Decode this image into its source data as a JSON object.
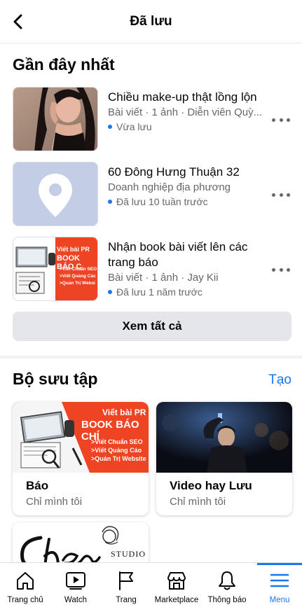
{
  "header": {
    "title": "Đã lưu"
  },
  "recent": {
    "title": "Gần đây nhất",
    "items": [
      {
        "title": "Chiều make-up thật lồng lộn",
        "meta": "Bài viết · 1 ảnh · Diễn viên Quỳ...",
        "saved": "Vừa lưu",
        "thumb": "portrait-photo"
      },
      {
        "title": "60 Đông Hưng Thuận 32",
        "meta": "Doanh nghiệp địa phương",
        "saved": "Đã lưu 10 tuần trước",
        "thumb": "location-pin-icon"
      },
      {
        "title": "Nhận book bài viết lên các trang báo",
        "meta": "Bài viết · 1 ảnh · Jay Kii",
        "saved": "Đã lưu 1 năm trước",
        "thumb": "pr-promo-image"
      }
    ],
    "see_all": "Xem tất cả"
  },
  "collections": {
    "title": "Bộ sưu tập",
    "create": "Tạo",
    "promo": {
      "l1": "Viết bài PR",
      "l2": "BOOK BÁO CHÍ",
      "l3": ">Viết Chuẩn SEO",
      "l4": ">Viết Quảng Cáo",
      "l5": ">Quản Trị Website"
    },
    "promo_small": {
      "l1": "Viết bài PR",
      "l2": "BOOK BÁO C",
      "l3": ">Viết Chuẩn SEO",
      "l4": ">Viết Quảng Các",
      "l5": ">Quản Trị Websi"
    },
    "items": [
      {
        "name": "Báo",
        "privacy": "Chỉ mình tôi"
      },
      {
        "name": "Video hay Lưu",
        "privacy": "Chỉ mình tôi"
      }
    ],
    "third_logo_text": "STUDIO"
  },
  "tabbar": {
    "tabs": [
      {
        "label": "Trang chủ",
        "icon": "home-icon"
      },
      {
        "label": "Watch",
        "icon": "watch-icon"
      },
      {
        "label": "Trang",
        "icon": "flag-icon"
      },
      {
        "label": "Marketplace",
        "icon": "marketplace-icon"
      },
      {
        "label": "Thông báo",
        "icon": "bell-icon"
      },
      {
        "label": "Menu",
        "icon": "menu-icon"
      }
    ],
    "active": "Menu"
  },
  "colors": {
    "accent": "#1877f2",
    "muted": "#65676b",
    "button_bg": "#e4e6eb",
    "promo_red": "#ef4423"
  }
}
